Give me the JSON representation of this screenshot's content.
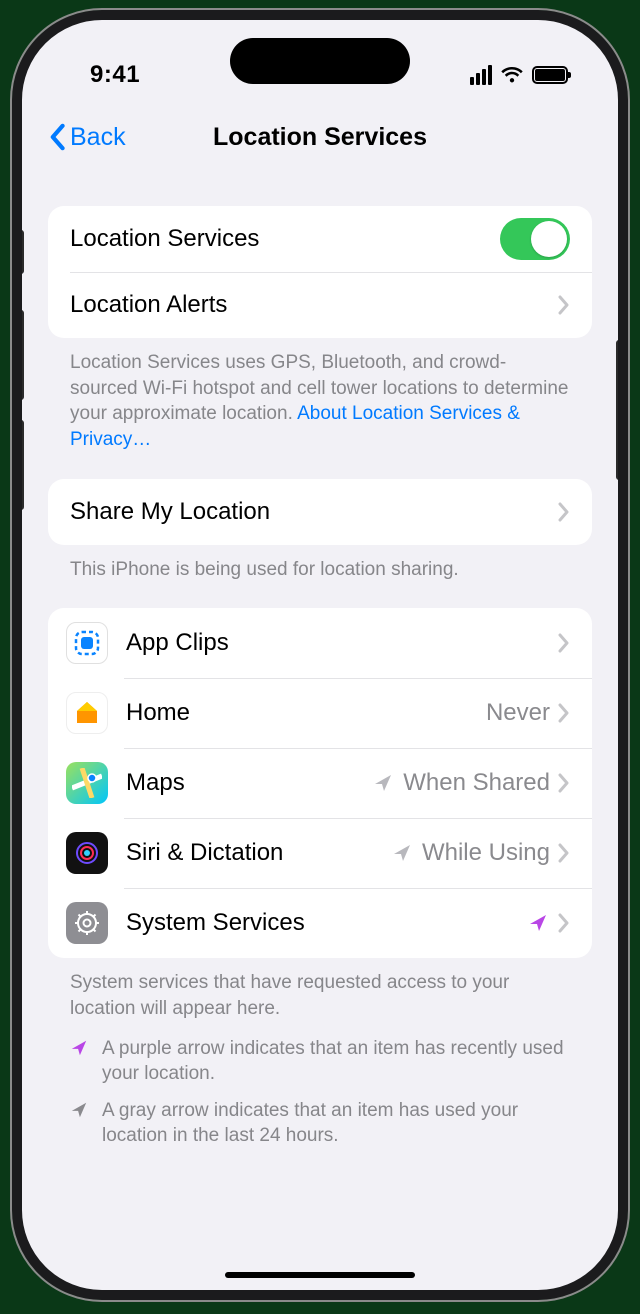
{
  "status": {
    "time": "9:41"
  },
  "nav": {
    "back": "Back",
    "title": "Location Services"
  },
  "main_toggle": {
    "label": "Location Services",
    "on": true
  },
  "alerts": {
    "label": "Location Alerts"
  },
  "desc": {
    "text": "Location Services uses GPS, Bluetooth, and crowd-sourced Wi-Fi hotspot and cell tower locations to determine your approximate location. ",
    "link": "About Location Services & Privacy…"
  },
  "share": {
    "label": "Share My Location",
    "footer": "This iPhone is being used for location sharing."
  },
  "apps": [
    {
      "name": "App Clips",
      "value": "",
      "indicator": "none"
    },
    {
      "name": "Home",
      "value": "Never",
      "indicator": "none"
    },
    {
      "name": "Maps",
      "value": "When Shared",
      "indicator": "gray"
    },
    {
      "name": "Siri & Dictation",
      "value": "While Using",
      "indicator": "gray"
    },
    {
      "name": "System Services",
      "value": "",
      "indicator": "purple"
    }
  ],
  "apps_footer": "System services that have requested access to your location will appear here.",
  "legend": {
    "purple": "A purple arrow indicates that an item has recently used your location.",
    "gray": "A gray arrow indicates that an item has used your location in the last 24 hours."
  },
  "colors": {
    "accent": "#007aff",
    "switch_on": "#34c759",
    "arrow_gray": "#b8b8bd",
    "arrow_purple": "#b946e6"
  }
}
